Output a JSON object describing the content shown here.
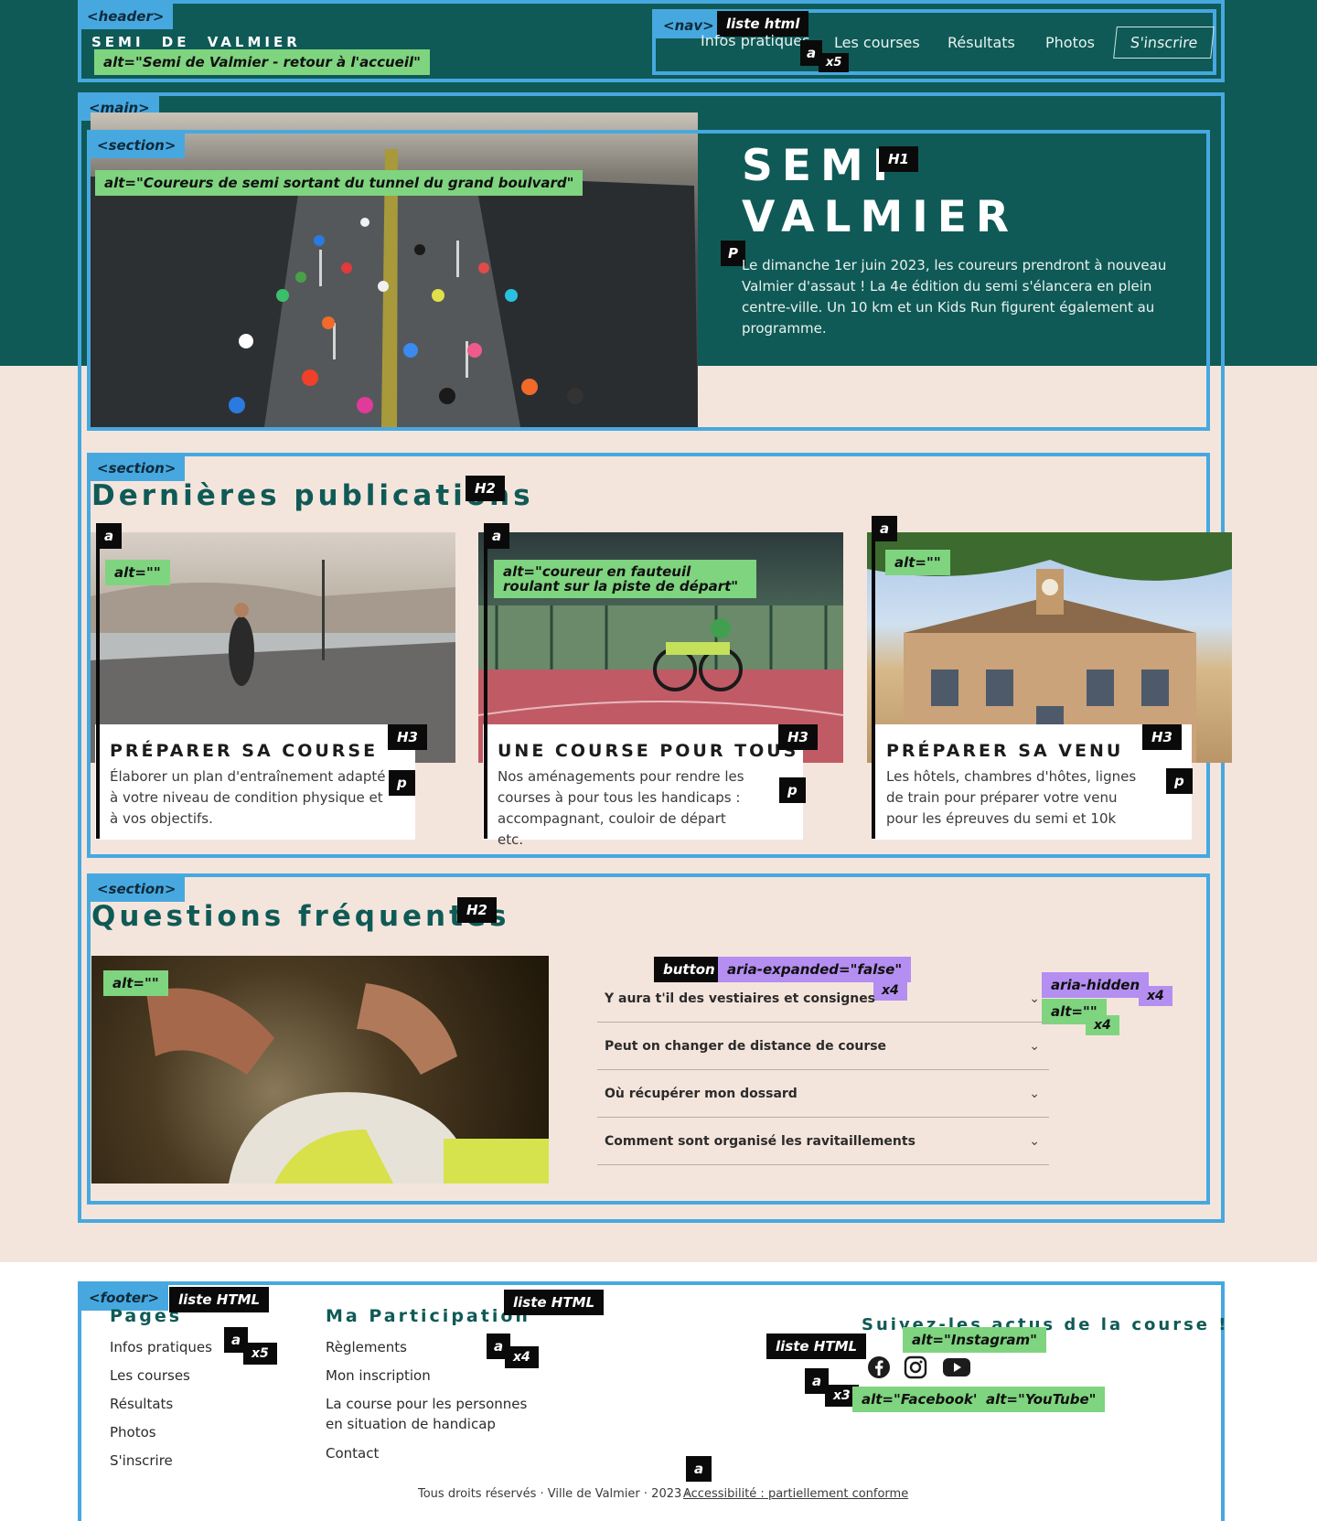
{
  "header": {
    "tag": "<header>",
    "logo_text": "SEMI DE VALMIER",
    "logo_alt": "alt=\"Semi de Valmier - retour à l'accueil\""
  },
  "nav": {
    "tag": "<nav>",
    "list_tag": "liste html",
    "a_tag": "a",
    "a_count": "x5",
    "items": [
      "Infos pratiques",
      "Les courses",
      "Résultats",
      "Photos",
      "S'inscrire"
    ]
  },
  "main": {
    "tag": "<main>"
  },
  "hero": {
    "section_tag": "<section>",
    "img_alt": "alt=\"Coureurs de semi sortant du tunnel du grand boulvard\"",
    "title_line1": "SEMI",
    "title_line2": "VALMIER",
    "h1_tag": "H1",
    "p_tag": "P",
    "intro": "Le dimanche 1er juin 2023, les coureurs prendront à nouveau Valmier d'assaut ! La 4e édition du semi s'élancera en plein centre-ville. Un 10 km et un Kids Run figurent également au programme."
  },
  "publications": {
    "section_tag": "<section>",
    "title": "Dernières publications",
    "h2_tag": "H2",
    "cards": [
      {
        "a_tag": "a",
        "alt": "alt=\"\"",
        "h3_tag": "H3",
        "p_tag": "p",
        "title": "PRÉPARER SA COURSE",
        "text": "Élaborer un plan d'entraînement adapté à votre niveau de condition physique et à vos objectifs."
      },
      {
        "a_tag": "a",
        "alt": "alt=\"coureur en fauteuil roulant sur la piste de départ\"",
        "h3_tag": "H3",
        "p_tag": "p",
        "title": "UNE COURSE POUR TOUS",
        "text": "Nos aménagements pour rendre les courses à pour tous les handicaps : accompagnant, couloir de départ etc."
      },
      {
        "a_tag": "a",
        "alt": "alt=\"\"",
        "h3_tag": "H3",
        "p_tag": "p",
        "title": "PRÉPARER SA VENU",
        "text": "Les hôtels, chambres d'hôtes, lignes de train pour préparer votre venu pour les épreuves du semi et 10k"
      }
    ]
  },
  "faq": {
    "section_tag": "<section>",
    "title": "Questions fréquentes",
    "h2_tag": "H2",
    "img_alt": "alt=\"\"",
    "button_tag": "button",
    "aria_expanded": "aria-expanded=\"false\"",
    "count_tag": "x4",
    "aria_hidden": "aria-hidden",
    "icon_alt": "alt=\"\"",
    "questions": [
      "Y aura t'il des vestiaires et consignes",
      "Peut on changer de distance de course",
      "Où récupérer mon dossard",
      "Comment sont organisé les ravitaillements"
    ]
  },
  "footer": {
    "tag": "<footer>",
    "pages": {
      "title": "Pages",
      "list_tag": "liste HTML",
      "a_tag": "a",
      "a_count": "x5",
      "links": [
        "Infos pratiques",
        "Les courses",
        "Résultats",
        "Photos",
        "S'inscrire"
      ]
    },
    "participation": {
      "title": "Ma Participation",
      "list_tag": "liste HTML",
      "a_tag": "a",
      "a_count": "x4",
      "links": [
        "Règlements",
        "Mon inscription",
        "La course pour les personnes en situation de handicap",
        "Contact"
      ]
    },
    "social": {
      "title": "Suivez-les actus de la course !",
      "list_tag": "liste HTML",
      "a_tag": "a",
      "a_count": "x3",
      "alt_instagram": "alt=\"Instagram\"",
      "alt_facebook": "alt=\"Facebook\"",
      "alt_youtube": "alt=\"YouTube\"",
      "icons": [
        "facebook-icon",
        "instagram-icon",
        "youtube-icon"
      ]
    },
    "copyright": "Tous droits réservés · Ville de Valmier · 2023 ·",
    "a11y_link": "Accessibilité : partiellement conforme",
    "a11y_a_tag": "a"
  },
  "colors": {
    "teal": "#0f5a56",
    "sand": "#f4e5dc",
    "annotation_blue": "#47a8e0",
    "annotation_green": "#7fd47f",
    "annotation_purple": "#b48ef0"
  }
}
